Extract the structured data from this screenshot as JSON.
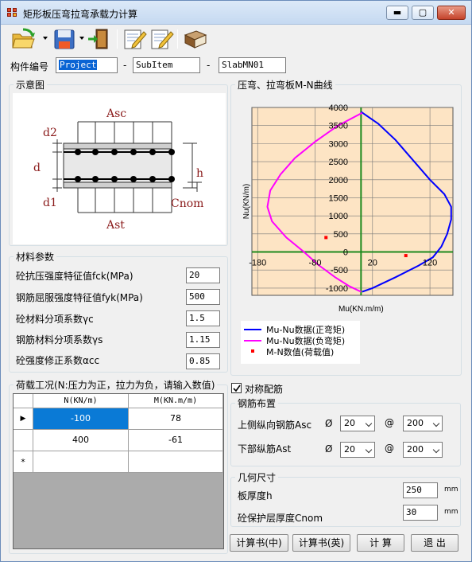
{
  "window": {
    "title": "矩形板压弯拉弯承载力计算",
    "minimize": "▬",
    "maximize": "▢",
    "close": "✕"
  },
  "toolbar": {
    "tools": [
      {
        "name": "open-icon"
      },
      {
        "name": "save-icon"
      },
      {
        "name": "exit-icon"
      },
      {
        "name": "edit-icon"
      },
      {
        "name": "edit-alt-icon"
      },
      {
        "name": "book-icon"
      }
    ]
  },
  "member": {
    "label": "构件编号",
    "project": "Project",
    "sep1": "-",
    "subitem": "SubItem",
    "sep2": "-",
    "slab": "SlabMN01"
  },
  "schematic": {
    "title": "示意图",
    "asc": "Asc",
    "ast": "Ast",
    "d2": "d2",
    "d": "d",
    "d1": "d1",
    "h": "h",
    "cnom": "Cnom"
  },
  "materials": {
    "title": "材料参数",
    "fields": [
      {
        "label": "砼抗压强度特征值fck(MPa)",
        "value": "20"
      },
      {
        "label": "钢筋屈服强度特征值fyk(MPa)",
        "value": "500"
      },
      {
        "label": "砼材料分项系数γc",
        "value": "1.5"
      },
      {
        "label": "钢筋材料分项系数γs",
        "value": "1.15"
      },
      {
        "label": "砼强度修正系数αcc",
        "value": "0.85"
      }
    ]
  },
  "loads": {
    "title": "荷载工况(N:压力为正，拉力为负，请输入数值)",
    "columns": [
      "N(KN/m)",
      "M(KN.m/m)"
    ],
    "rows": [
      {
        "n": "-100",
        "m": "78"
      },
      {
        "n": "400",
        "m": "-61"
      }
    ],
    "current_marker": "▶",
    "new_marker": "*"
  },
  "chart_data": {
    "type": "scatter",
    "title": "压弯、拉弯板M-N曲线",
    "xlabel": "Mu(KN.m/m)",
    "ylabel": "Nu(KN/m)",
    "xlim": [
      -190,
      160
    ],
    "ylim": [
      -1200,
      4000
    ],
    "x_ticks": [
      -180,
      -80,
      20,
      120
    ],
    "y_ticks": [
      4000,
      3500,
      3000,
      2500,
      2000,
      1500,
      1000,
      500,
      0,
      -500,
      -1000
    ],
    "grid": true,
    "background": "#fde4c4",
    "series": [
      {
        "name": "Mu-Nu数据(正弯矩)",
        "color": "#0000ff",
        "points": [
          [
            2,
            -1100
          ],
          [
            20,
            -1000
          ],
          [
            60,
            -700
          ],
          [
            100,
            -380
          ],
          [
            125,
            -150
          ],
          [
            140,
            150
          ],
          [
            150,
            500
          ],
          [
            157,
            900
          ],
          [
            157,
            1250
          ],
          [
            145,
            1600
          ],
          [
            120,
            2000
          ],
          [
            90,
            2550
          ],
          [
            60,
            3100
          ],
          [
            30,
            3550
          ],
          [
            0,
            3880
          ]
        ]
      },
      {
        "name": "Mu-Nu数据(负弯矩)",
        "color": "#ff00ff",
        "points": [
          [
            2,
            3850
          ],
          [
            -40,
            3500
          ],
          [
            -80,
            3050
          ],
          [
            -115,
            2600
          ],
          [
            -140,
            2150
          ],
          [
            -158,
            1700
          ],
          [
            -163,
            1250
          ],
          [
            -155,
            850
          ],
          [
            -130,
            400
          ],
          [
            -100,
            10
          ],
          [
            -75,
            -350
          ],
          [
            -45,
            -700
          ],
          [
            -20,
            -950
          ],
          [
            0,
            -1100
          ]
        ]
      },
      {
        "name": "M-N数值(荷载值)",
        "color": "#ff0000",
        "marker": "square",
        "points": [
          [
            78,
            -100
          ],
          [
            -61,
            400
          ]
        ]
      }
    ],
    "legend_position": "bottom"
  },
  "symmetric": {
    "label": "对称配筋",
    "checked": true
  },
  "rebar": {
    "title": "钢筋布置",
    "top_label": "上侧纵向钢筋Asc",
    "bottom_label": "下部纵筋Ast",
    "phi": "Ø",
    "at": "@",
    "top_dia": "20",
    "top_spacing": "200",
    "bottom_dia": "20",
    "bottom_spacing": "200"
  },
  "geometry": {
    "title": "几何尺寸",
    "thickness_label": "板厚度h",
    "thickness_value": "250",
    "cover_label": "砼保护层厚度Cnom",
    "cover_value": "30",
    "unit": "mm"
  },
  "actions": {
    "report_cn": "计算书(中)",
    "report_en": "计算书(英)",
    "calculate": "计  算",
    "exit": "退  出"
  }
}
